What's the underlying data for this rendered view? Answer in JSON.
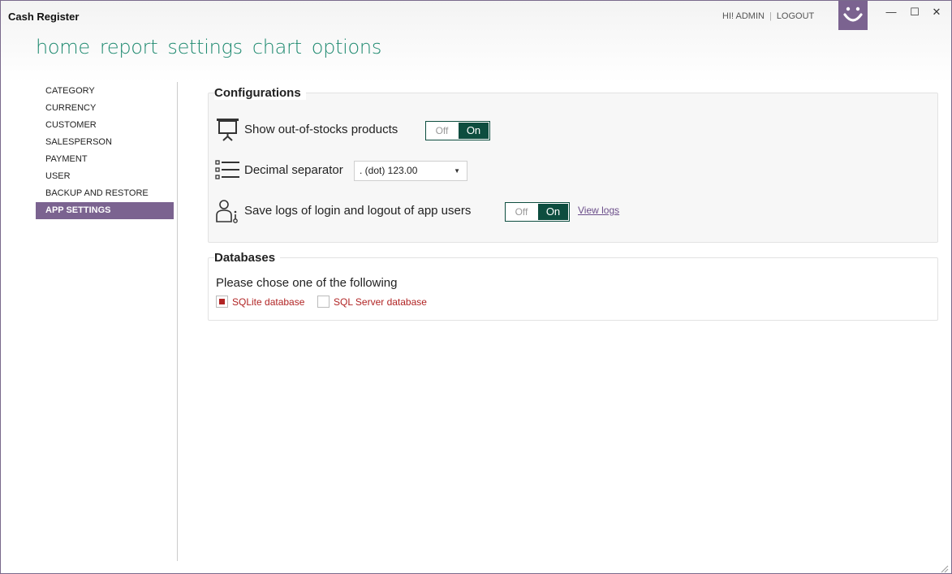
{
  "app": {
    "title": "Cash Register"
  },
  "header": {
    "greeting": "HI! ADMIN",
    "separator": "|",
    "logout": "LOGOUT"
  },
  "window_controls": {
    "minimize": "—",
    "maximize": "☐",
    "close": "✕"
  },
  "main_nav": [
    "home",
    "report",
    "settings",
    "chart",
    "options"
  ],
  "sidebar": {
    "items": [
      {
        "label": "CATEGORY",
        "active": false
      },
      {
        "label": "CURRENCY",
        "active": false
      },
      {
        "label": "CUSTOMER",
        "active": false
      },
      {
        "label": "SALESPERSON",
        "active": false
      },
      {
        "label": "PAYMENT",
        "active": false
      },
      {
        "label": "USER",
        "active": false
      },
      {
        "label": "BACKUP AND RESTORE",
        "active": false
      },
      {
        "label": "APP SETTINGS",
        "active": true
      }
    ]
  },
  "configurations": {
    "title": "Configurations",
    "out_of_stock": {
      "label": "Show out-of-stocks products",
      "off": "Off",
      "on": "On",
      "value": "On"
    },
    "decimal": {
      "label": "Decimal separator",
      "value": ". (dot) 123.00"
    },
    "logs": {
      "label": "Save logs of login and logout of app users",
      "off": "Off",
      "on": "On",
      "value": "On",
      "link": "View logs"
    }
  },
  "databases": {
    "title": "Databases",
    "prompt": "Please chose one of the following",
    "options": [
      {
        "label": "SQLite database",
        "checked": true
      },
      {
        "label": "SQL Server database",
        "checked": false
      }
    ]
  },
  "colors": {
    "accent": "#7b6390",
    "nav": "#1f8a70",
    "toggle": "#0d4d3f",
    "db_option": "#b12424"
  }
}
